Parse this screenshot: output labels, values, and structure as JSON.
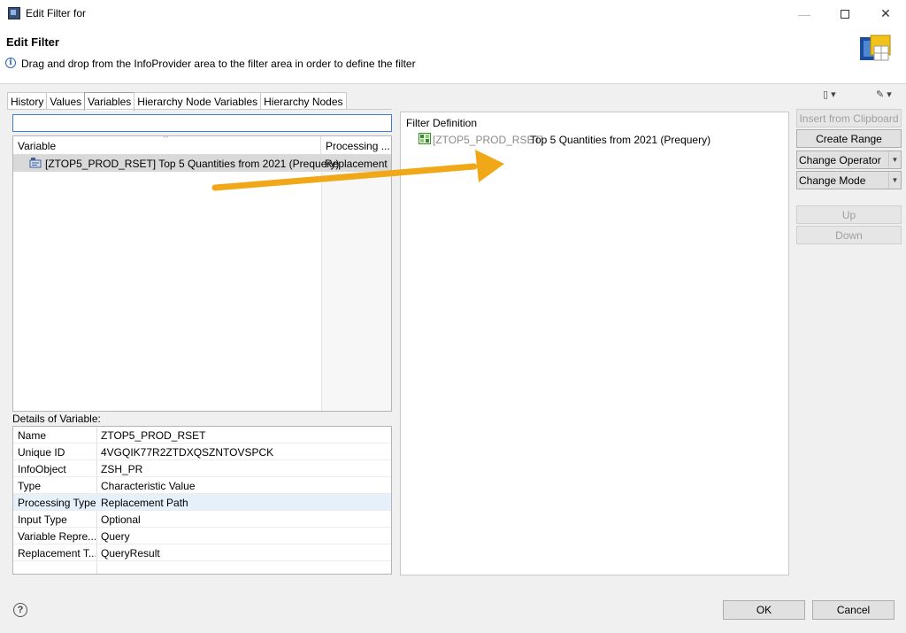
{
  "window": {
    "title": "Edit Filter for"
  },
  "header": {
    "heading": "Edit Filter",
    "info": "Drag and drop from the InfoProvider area to the filter area in order to define the filter"
  },
  "tabs": [
    {
      "label": "History"
    },
    {
      "label": "Values"
    },
    {
      "label": "Variables",
      "active": true
    },
    {
      "label": "Hierarchy Node Variables"
    },
    {
      "label": "Hierarchy Nodes"
    }
  ],
  "search": {
    "value": ""
  },
  "variable_table": {
    "columns": [
      "Variable",
      "Processing ..."
    ],
    "rows": [
      {
        "variable": "[ZTOP5_PROD_RSET] Top 5 Quantities from 2021 (Prequery)",
        "processing": "Replacement P"
      }
    ]
  },
  "details": {
    "label": "Details of Variable:",
    "rows": [
      {
        "key": "Name",
        "value": "ZTOP5_PROD_RSET"
      },
      {
        "key": "Unique ID",
        "value": "4VGQIK77R2ZTDXQSZNTOVSPCK"
      },
      {
        "key": "InfoObject",
        "value": "ZSH_PR"
      },
      {
        "key": "Type",
        "value": "Characteristic Value"
      },
      {
        "key": "Processing Type",
        "value": "Replacement Path"
      },
      {
        "key": "Input Type",
        "value": "Optional"
      },
      {
        "key": "Variable Repre...",
        "value": "Query"
      },
      {
        "key": "Replacement T...",
        "value": "QueryResult"
      }
    ]
  },
  "filter": {
    "title": "Filter Definition",
    "entry_key": "[ZTOP5_PROD_RSET]",
    "entry_text": "Top 5 Quantities from 2021 (Prequery)"
  },
  "side_buttons": {
    "insert_clipboard": "Insert from Clipboard",
    "create_range": "Create Range",
    "change_operator": "Change Operator",
    "change_mode": "Change Mode",
    "up": "Up",
    "down": "Down"
  },
  "footer": {
    "ok": "OK",
    "cancel": "Cancel"
  },
  "colors": {
    "arrow": "#f0a818",
    "selection": "#d9d9d9",
    "focus_border": "#3c7fd8"
  }
}
